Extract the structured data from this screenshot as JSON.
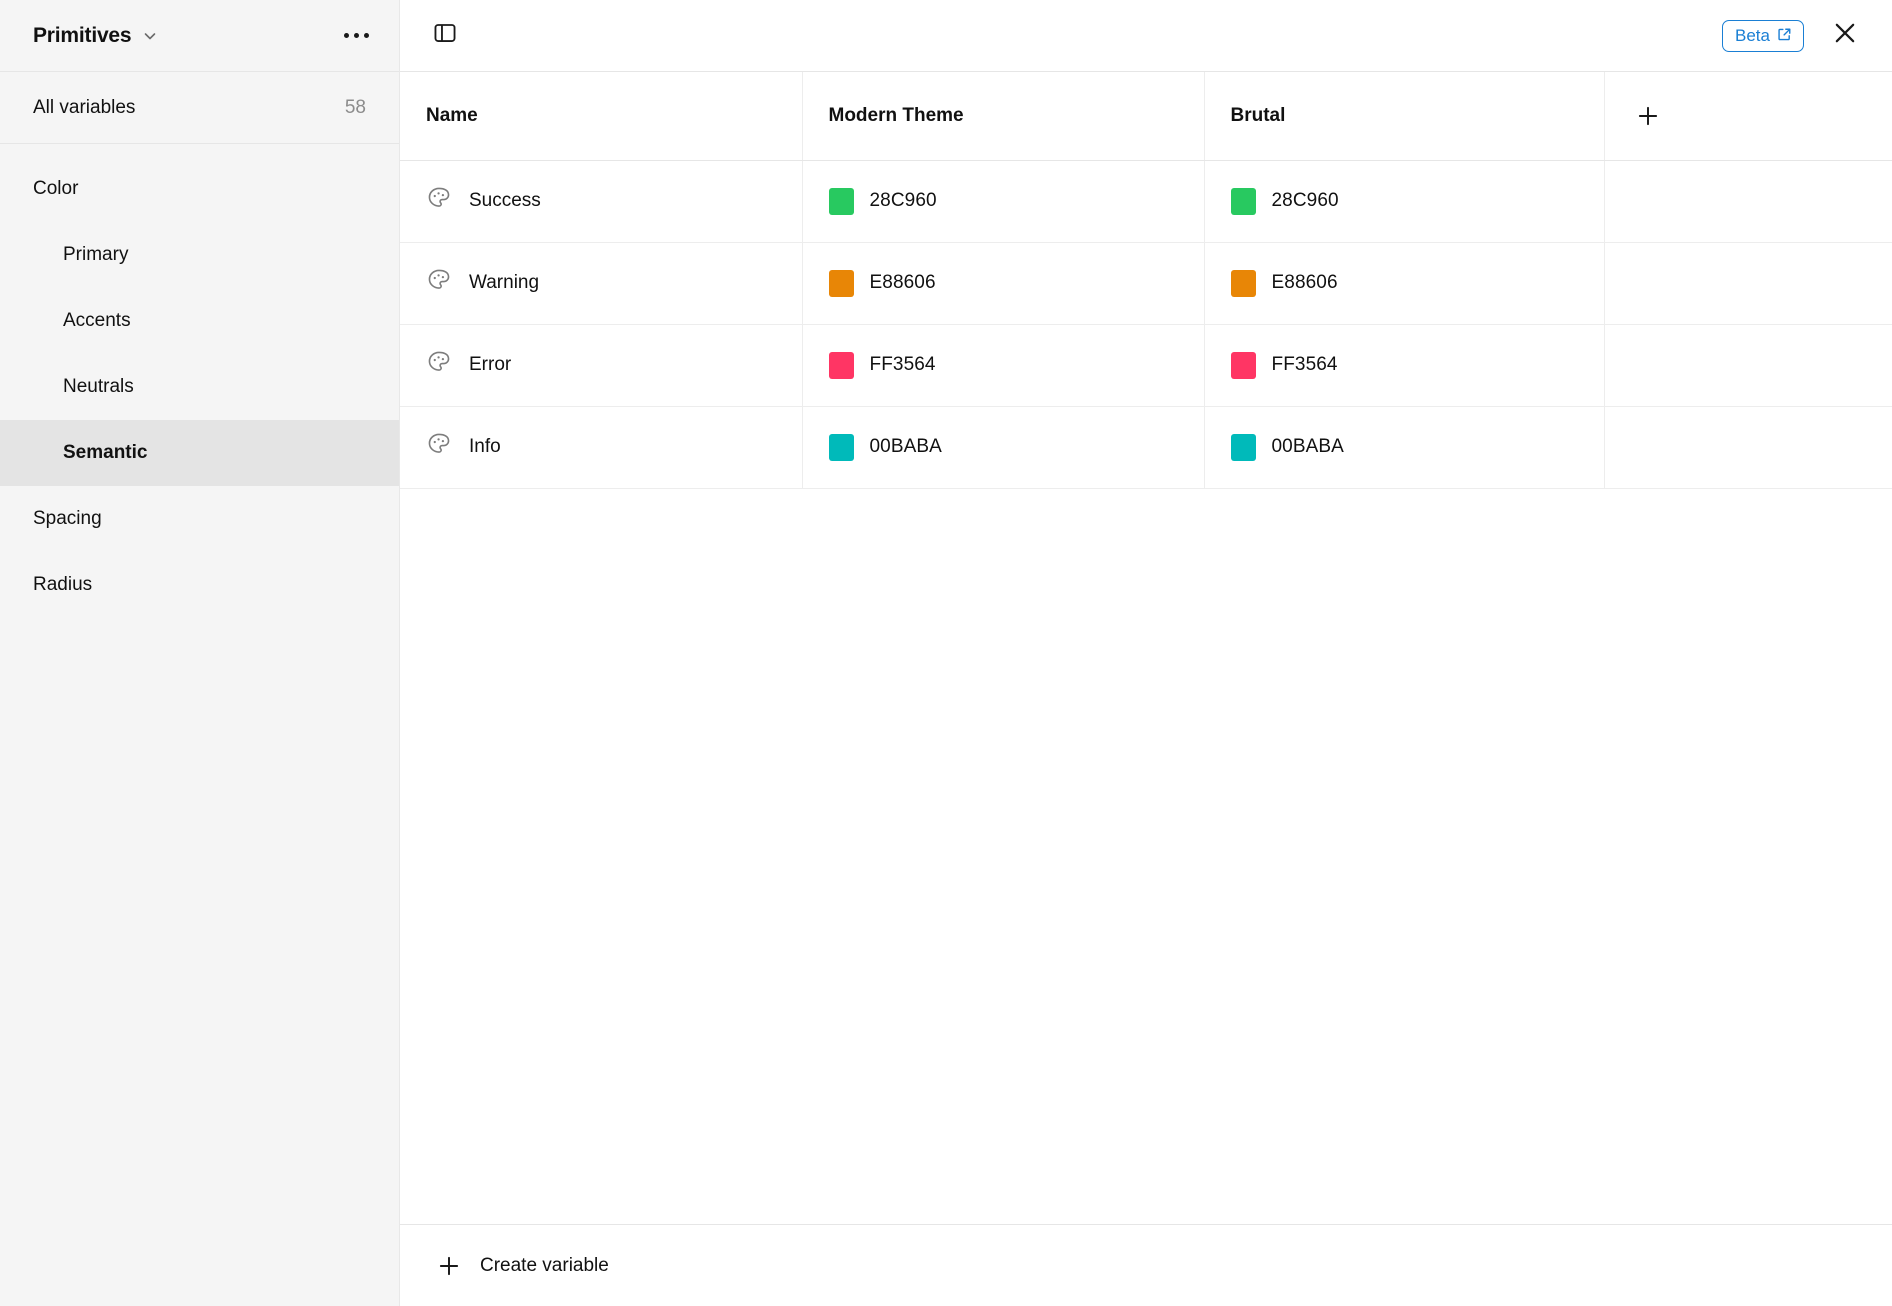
{
  "sidebar": {
    "collection_name": "Primitives",
    "collection_chevron_icon": "chevron-down-icon",
    "more_icon": "ellipsis-icon",
    "all_variables_label": "All variables",
    "all_variables_count": "58",
    "groups": [
      {
        "label": "Color",
        "level": 0,
        "selected": false
      },
      {
        "label": "Primary",
        "level": 1,
        "selected": false
      },
      {
        "label": "Accents",
        "level": 1,
        "selected": false
      },
      {
        "label": "Neutrals",
        "level": 1,
        "selected": false
      },
      {
        "label": "Semantic",
        "level": 1,
        "selected": true
      },
      {
        "label": "Spacing",
        "level": 0,
        "selected": false
      },
      {
        "label": "Radius",
        "level": 0,
        "selected": false
      }
    ]
  },
  "toolbar": {
    "panel_toggle_icon": "sidebar-panel-icon",
    "beta_label": "Beta",
    "beta_external_icon": "external-link-icon",
    "close_icon": "close-icon",
    "beta_accent_color": "#1A7FD4"
  },
  "table": {
    "columns": [
      {
        "key": "name",
        "label": "Name"
      },
      {
        "key": "mode1",
        "label": "Modern Theme"
      },
      {
        "key": "mode2",
        "label": "Brutal"
      }
    ],
    "add_column_icon": "plus-icon",
    "row_icon": "color-palette-icon",
    "rows": [
      {
        "name": "Success",
        "mode1_value": "28C960",
        "mode1_color": "#28C960",
        "mode2_value": "28C960",
        "mode2_color": "#28C960"
      },
      {
        "name": "Warning",
        "mode1_value": "E88606",
        "mode1_color": "#E88606",
        "mode2_value": "E88606",
        "mode2_color": "#E88606"
      },
      {
        "name": "Error",
        "mode1_value": "FF3564",
        "mode1_color": "#FF3564",
        "mode2_value": "FF3564",
        "mode2_color": "#FF3564"
      },
      {
        "name": "Info",
        "mode1_value": "00BABA",
        "mode1_color": "#00BABA",
        "mode2_value": "00BABA",
        "mode2_color": "#00BABA"
      }
    ]
  },
  "footer": {
    "create_label": "Create variable",
    "create_icon": "plus-icon"
  }
}
